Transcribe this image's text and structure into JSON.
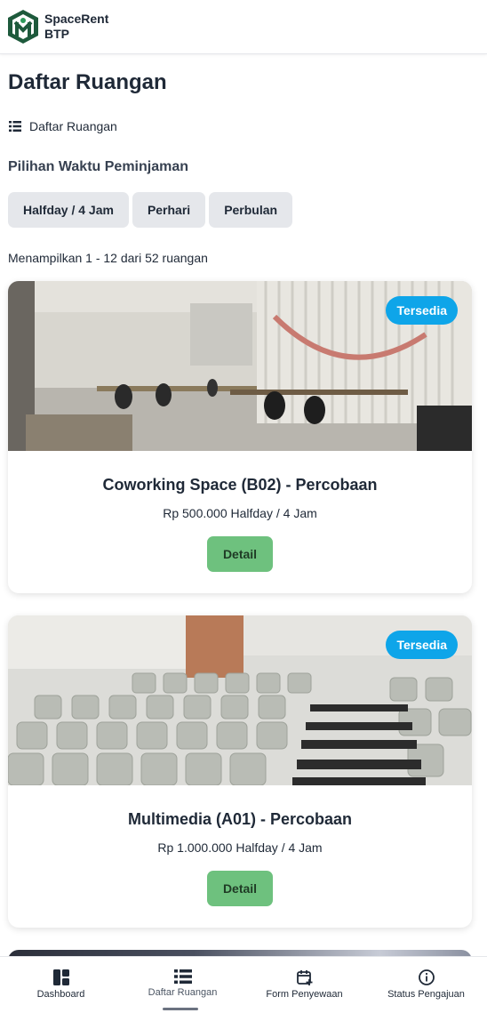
{
  "brand": {
    "line1": "SpaceRent",
    "line2": "BTP"
  },
  "page": {
    "title": "Daftar Ruangan",
    "breadcrumb": "Daftar Ruangan",
    "section_label": "Pilihan Waktu Peminjaman",
    "count_text": "Menampilkan 1 - 12 dari 52 ruangan"
  },
  "filters": [
    "Halfday / 4 Jam",
    "Perhari",
    "Perbulan"
  ],
  "rooms": [
    {
      "name": "Coworking Space (B02) - Percobaan",
      "price": "Rp 500.000 Halfday / 4 Jam",
      "status": "Tersedia",
      "detail_label": "Detail"
    },
    {
      "name": "Multimedia (A01) - Percobaan",
      "price": "Rp 1.000.000 Halfday / 4 Jam",
      "status": "Tersedia",
      "detail_label": "Detail"
    }
  ],
  "nav": [
    {
      "label": "Dashboard",
      "icon": "dashboard-icon"
    },
    {
      "label": "Daftar Ruangan",
      "icon": "list-icon"
    },
    {
      "label": "Form Penyewaan",
      "icon": "calendar-plus-icon"
    },
    {
      "label": "Status Pengajuan",
      "icon": "info-icon"
    }
  ],
  "colors": {
    "badge": "#0ea5e9",
    "detail_button": "#6ec17e",
    "logo": "#1e5a3c"
  }
}
